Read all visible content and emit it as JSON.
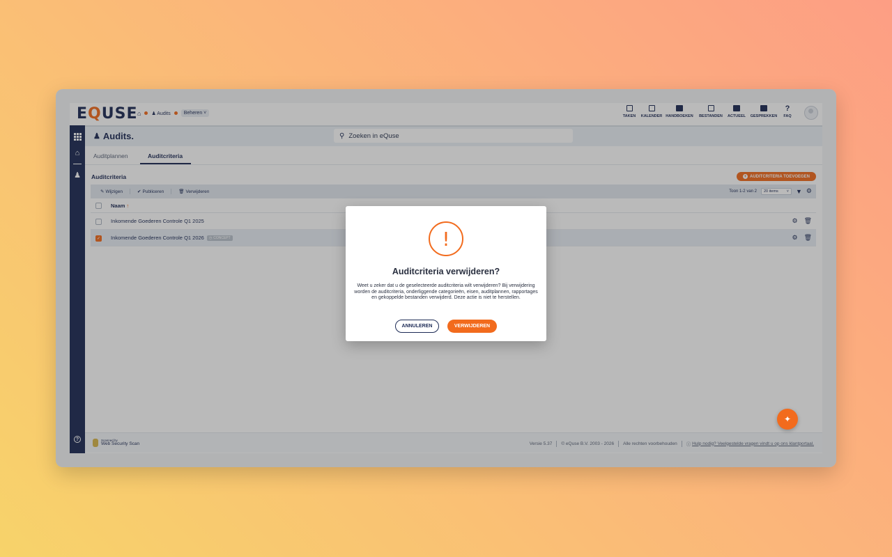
{
  "colors": {
    "accent": "#f26b1d",
    "navy": "#1c2a55"
  },
  "logo": {
    "pre": "E",
    "q": "Q",
    "post": "USE"
  },
  "breadcrumb": {
    "home_icon": "home-icon",
    "audits": "Audits",
    "beheren": "Beheren"
  },
  "topnav": {
    "items": [
      {
        "label": "TAKEN",
        "icon": "clipboard-icon"
      },
      {
        "label": "KALENDER",
        "icon": "calendar-icon"
      },
      {
        "label": "HANDBOEKEN",
        "icon": "book-icon"
      },
      {
        "label": "BESTANDEN",
        "icon": "archive-icon"
      },
      {
        "label": "ACTUEEL",
        "icon": "news-icon"
      },
      {
        "label": "GESPREKKEN",
        "icon": "chat-icon"
      },
      {
        "label": "FAQ",
        "icon": "question-icon"
      }
    ]
  },
  "header": {
    "title": "Audits.",
    "search_placeholder": "Zoeken in eQuse"
  },
  "tabs": [
    {
      "label": "Auditplannen"
    },
    {
      "label": "Auditcriteria"
    }
  ],
  "section": {
    "title": "Auditcriteria",
    "add_label": "AUDITCRITERIA TOEVOEGEN"
  },
  "toolbar": {
    "edit": "Wijzigen",
    "publish": "Publiceren",
    "delete": "Verwijderen",
    "pager_text": "Toon 1-2 van 2",
    "page_size": "20 items"
  },
  "table": {
    "header_name": "Naam",
    "rows": [
      {
        "name": "Inkomende Goederen Controle Q1 2025",
        "checked": false
      },
      {
        "name": "Inkomende Goederen Controle Q1 2026",
        "checked": true,
        "badge": "CONCEPT"
      }
    ]
  },
  "footer": {
    "scan_small": "Scanned by",
    "scan_big": "Web Security Scan",
    "version": "Versie 5.37",
    "copyright": "© eQuse B.V. 2003 - 2026",
    "rights": "Alle rechten voorbehouden",
    "help": "Hulp nodig? Veelgestelde vragen vindt u op ons klantportaal."
  },
  "dialog": {
    "title": "Auditcriteria verwijderen?",
    "message": "Weet u zeker dat u de geselecteerde auditcriteria wilt verwijderen? Bij verwijdering worden de auditcriteria, onderliggende categorieën, eisen, auditplannen, rapportages en gekoppelde bestanden verwijderd. Deze actie is niet te herstellen.",
    "cancel_label": "ANNULEREN",
    "confirm_label": "VERWIJDEREN"
  }
}
